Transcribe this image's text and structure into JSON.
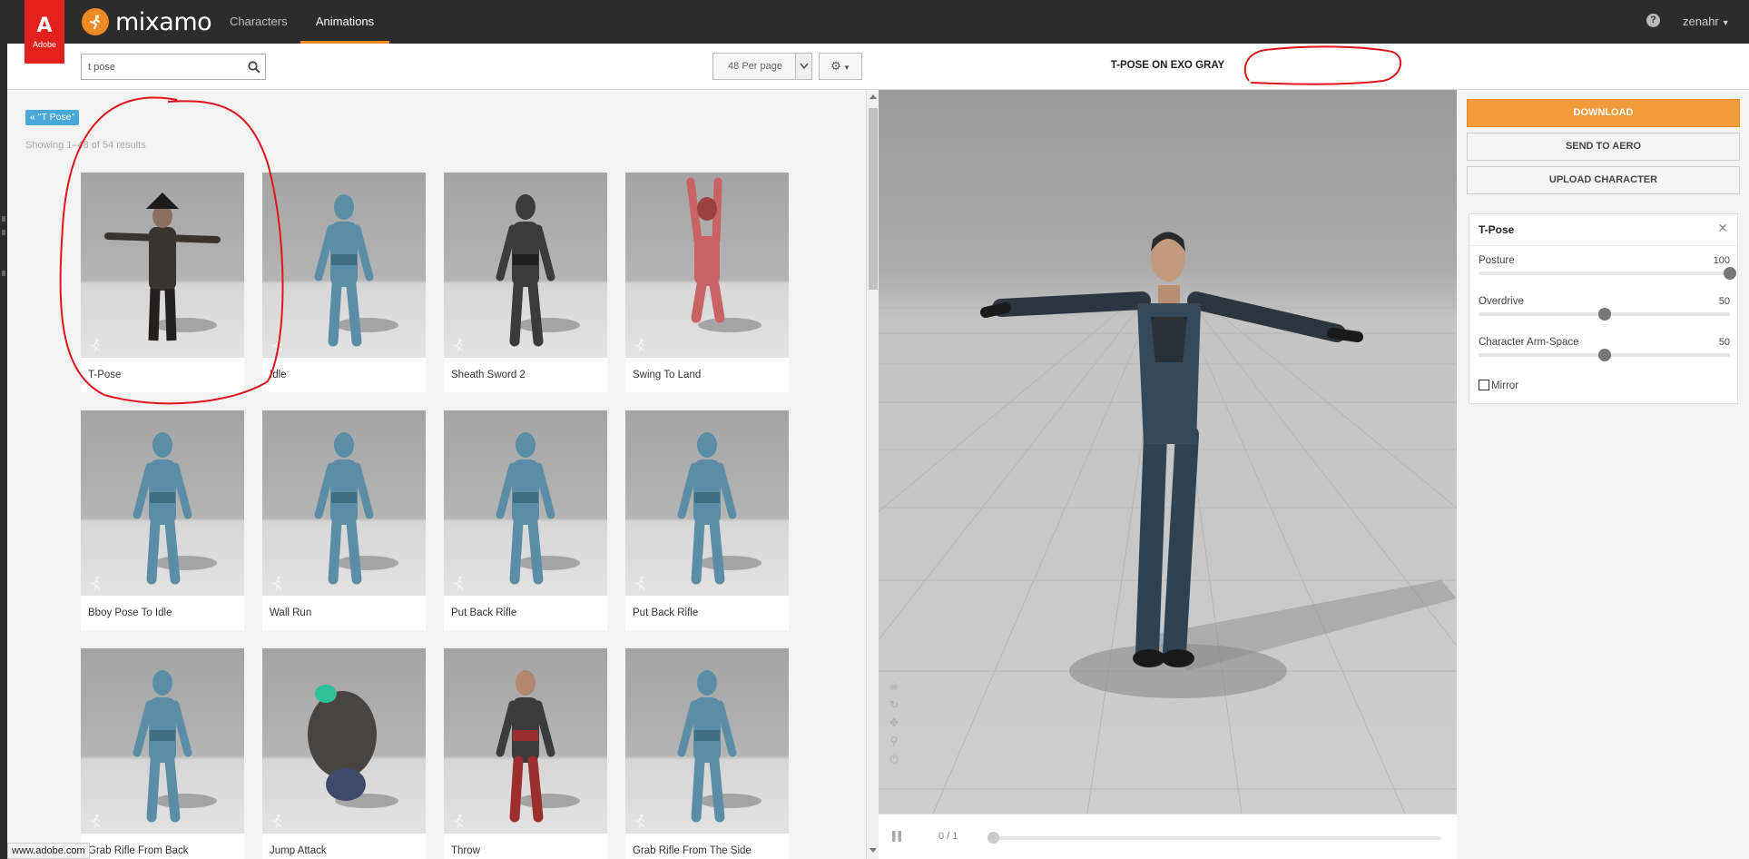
{
  "topnav": {
    "adobe_glyph": "A",
    "adobe_word": "Adobe",
    "brand": "mixamo",
    "tabs": [
      {
        "label": "Characters",
        "active": false
      },
      {
        "label": "Animations",
        "active": true
      }
    ],
    "help_glyph": "?",
    "user": "zenahr"
  },
  "search": {
    "value": "t pose",
    "per_page": "48 Per page"
  },
  "filter_tag": "« \"T Pose\"",
  "results_text": "Showing 1–48 of 54 results",
  "cards": [
    {
      "label": "T-Pose",
      "style": "tpose-dark"
    },
    {
      "label": "Idle",
      "style": "blue"
    },
    {
      "label": "Sheath Sword 2",
      "style": "armor"
    },
    {
      "label": "Swing To Land",
      "style": "red-hang"
    },
    {
      "label": "Bboy Pose To Idle",
      "style": "blue-lean"
    },
    {
      "label": "Wall Run",
      "style": "blue-run"
    },
    {
      "label": "Put Back Rifle",
      "style": "blue"
    },
    {
      "label": "Put Back Rifle",
      "style": "blue"
    },
    {
      "label": "Grab Rifle From Back",
      "style": "blue"
    },
    {
      "label": "Jump Attack",
      "style": "beast"
    },
    {
      "label": "Throw",
      "style": "red-suit"
    },
    {
      "label": "Grab Rifle From The Side",
      "style": "blue"
    }
  ],
  "statusbar": "www.adobe.com",
  "viewer": {
    "title": "T-POSE ON EXO GRAY",
    "frame": "0 / 1",
    "progress": 0
  },
  "actions": {
    "download": "DOWNLOAD",
    "send": "SEND TO AERO",
    "upload": "UPLOAD CHARACTER"
  },
  "settings": {
    "title": "T-Pose",
    "close": "✕",
    "sliders": [
      {
        "label": "Posture",
        "value": "100",
        "fraction": 1.0
      },
      {
        "label": "Overdrive",
        "value": "50",
        "fraction": 0.5
      },
      {
        "label": "Character Arm-Space",
        "value": "50",
        "fraction": 0.5
      }
    ],
    "mirror_label": "Mirror",
    "mirror_checked": false
  },
  "colors": {
    "accent": "#f08a24",
    "nav_bg": "#2c2c2c",
    "download_bg": "#f39b3b",
    "filter_tag": "#4aa8d8",
    "annotation": "#e0141e"
  }
}
